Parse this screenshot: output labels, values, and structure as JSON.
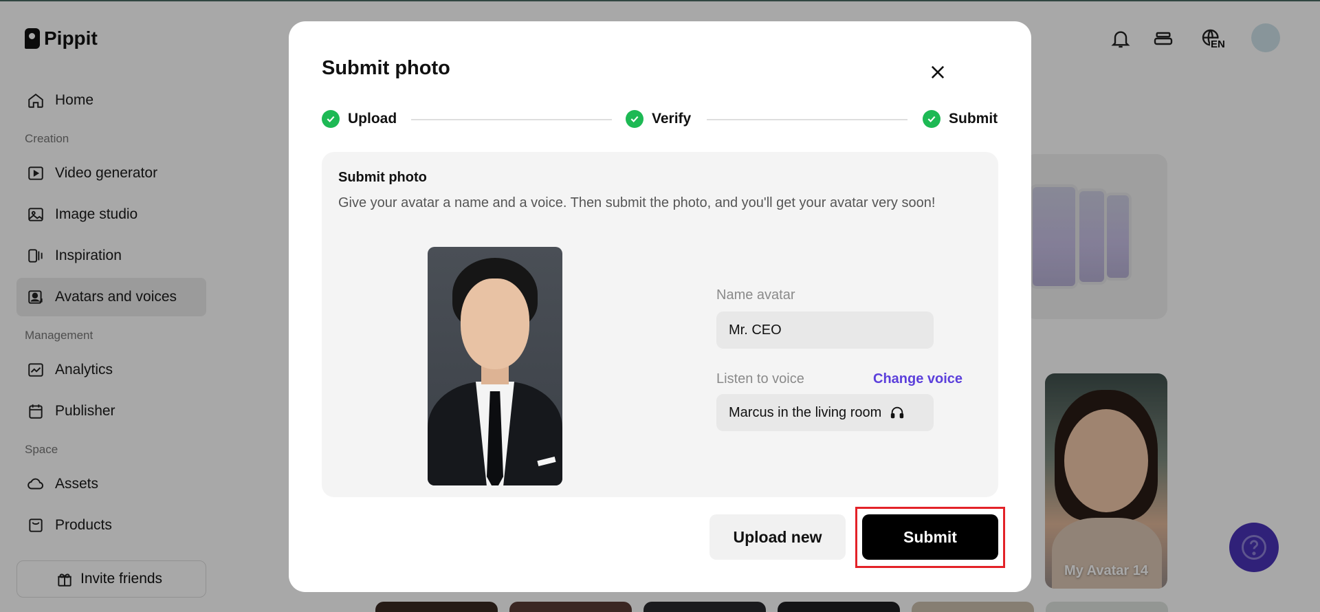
{
  "app": {
    "brand": "Pippit",
    "nav": {
      "home": "Home",
      "section_creation": "Creation",
      "video_generator": "Video generator",
      "image_studio": "Image studio",
      "inspiration": "Inspiration",
      "avatars_and_voices": "Avatars and voices",
      "section_management": "Management",
      "analytics": "Analytics",
      "publisher": "Publisher",
      "section_space": "Space",
      "assets": "Assets",
      "products": "Products"
    },
    "invite_friends": "Invite friends",
    "topbar": {
      "language_badge": "EN"
    },
    "background_avatar_label": "My Avatar 14"
  },
  "modal": {
    "title": "Submit photo",
    "steps": [
      {
        "label": "Upload",
        "status": "complete"
      },
      {
        "label": "Verify",
        "status": "complete"
      },
      {
        "label": "Submit",
        "status": "complete"
      }
    ],
    "panel": {
      "title": "Submit photo",
      "description": "Give your avatar a name and a voice. Then submit the photo, and you'll get your avatar very soon!"
    },
    "form": {
      "name_label": "Name avatar",
      "name_value": "Mr. CEO",
      "voice_label": "Listen to voice",
      "change_voice": "Change voice",
      "voice_value": "Marcus in the living room"
    },
    "buttons": {
      "upload_new": "Upload new",
      "submit": "Submit"
    }
  },
  "colors": {
    "accent_purple": "#5b3fdb",
    "step_green": "#1db954",
    "highlight_red": "#e32228",
    "help_button": "#4a32b8"
  }
}
